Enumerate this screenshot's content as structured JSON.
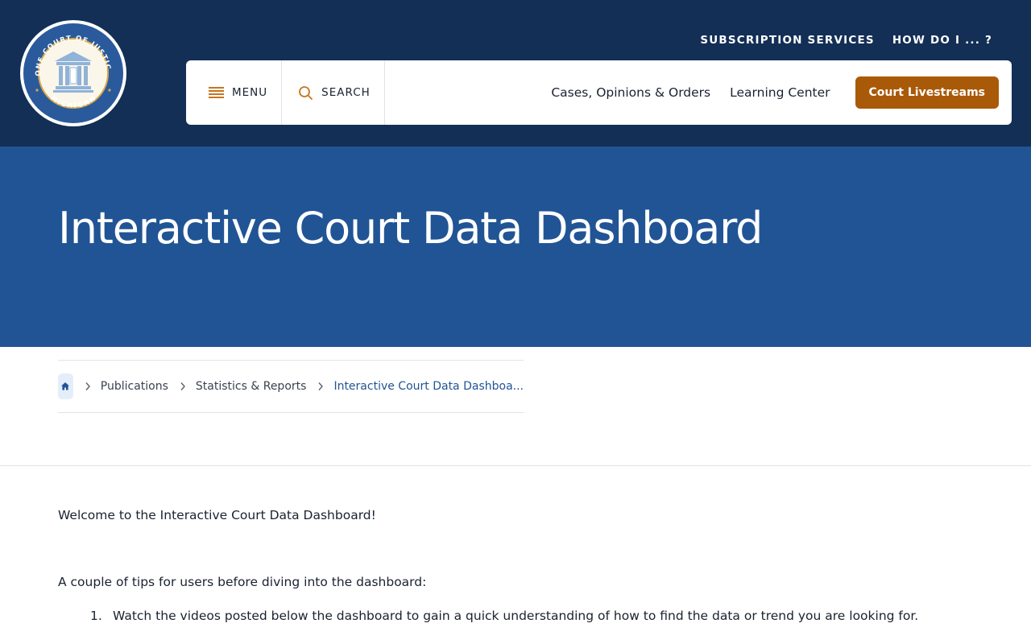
{
  "header": {
    "logo": {
      "top_text": "ONE COURT OF JUSTICE",
      "bottom_text": "MICHIGAN",
      "colors": {
        "ring": "#2a5a9c",
        "inner": "#fbf6ea",
        "gold": "#d7a94a"
      }
    },
    "utility_nav": [
      {
        "label": "SUBSCRIPTION SERVICES"
      },
      {
        "label": "HOW DO I ... ?"
      }
    ],
    "menu_label": "MENU",
    "search_label": "SEARCH",
    "nav_links": [
      {
        "label": "Cases, Opinions & Orders"
      },
      {
        "label": "Learning Center"
      }
    ],
    "cta_label": "Court Livestreams"
  },
  "hero": {
    "title": "Interactive Court Data Dashboard"
  },
  "breadcrumb": {
    "home_icon": "home-icon",
    "items": [
      {
        "label": "Publications"
      },
      {
        "label": "Statistics & Reports"
      },
      {
        "label": "Interactive Court Data Dashboa..."
      }
    ]
  },
  "content": {
    "intro": "Welcome to the Interactive Court Data Dashboard!",
    "tips_heading": "A couple of tips for users before diving into the dashboard:",
    "tips": [
      {
        "number": "1.",
        "text": "Watch the videos posted below the dashboard to gain a quick understanding of how to find the data or trend you are looking for."
      }
    ]
  },
  "colors": {
    "header_bg": "#132f56",
    "hero_bg": "#215494",
    "accent_orange": "#a95a08",
    "icon_orange": "#c6761d"
  }
}
